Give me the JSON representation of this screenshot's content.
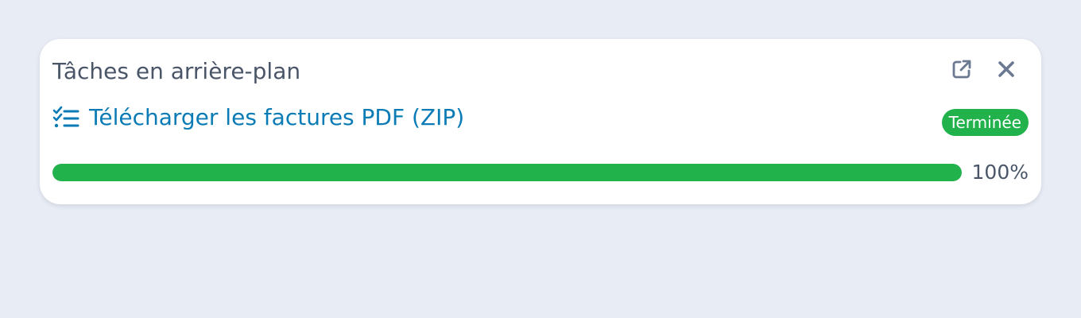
{
  "panel": {
    "title": "Tâches en arrière-plan",
    "actions": [
      {
        "name": "open-external",
        "icon": "external-link-icon"
      },
      {
        "name": "close",
        "icon": "close-icon"
      }
    ]
  },
  "task": {
    "icon": "task-list-icon",
    "label": "Télécharger les factures PDF (ZIP)",
    "status": "Terminée",
    "progress": 100,
    "progress_label": "100%"
  },
  "colors": {
    "background": "#e8ecf4",
    "panel": "#ffffff",
    "text_muted": "#4a5568",
    "link": "#0a7bb5",
    "success": "#22b24c",
    "icon_gray": "#6b7892"
  }
}
